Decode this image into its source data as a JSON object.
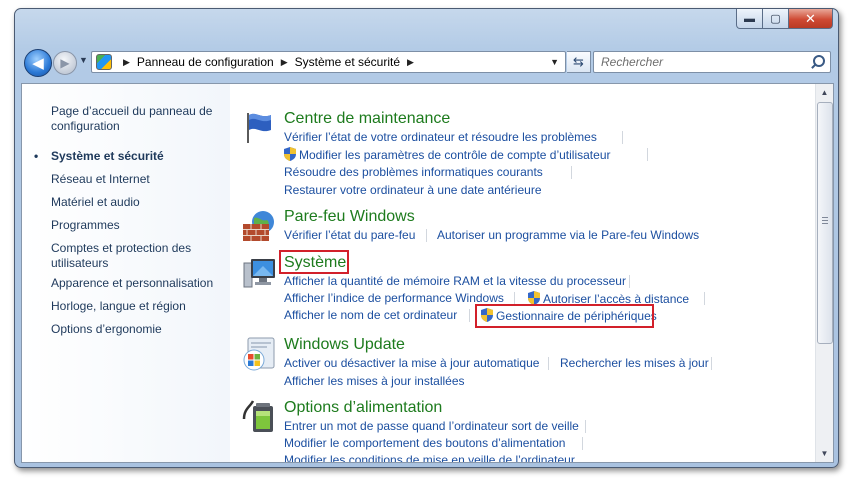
{
  "window": {
    "caption_minimize": "▬",
    "caption_maximize": "▢",
    "caption_close": "✕"
  },
  "toolbar": {
    "back_glyph": "◀",
    "forward_glyph": "▶",
    "history_glyph": "▼",
    "crumb_separator": "▶",
    "breadcrumbs": [
      "Panneau de configuration",
      "Système et sécurité"
    ],
    "address_dropdown_glyph": "▼",
    "refresh_glyph": "⇆",
    "search_placeholder": "Rechercher"
  },
  "sidebar": {
    "items": [
      {
        "label": "Page d’accueil du panneau de configuration"
      },
      {
        "label": "Système et sécurité",
        "active": true,
        "bullet": "•"
      },
      {
        "label": "Réseau et Internet"
      },
      {
        "label": "Matériel et audio"
      },
      {
        "label": "Programmes"
      },
      {
        "label": "Comptes et protection des utilisateurs"
      },
      {
        "label": "Apparence et personnalisation"
      },
      {
        "label": "Horloge, langue et région"
      },
      {
        "label": "Options d’ergonomie"
      }
    ]
  },
  "categories": [
    {
      "title": "Centre de maintenance",
      "icon": "flag-icon",
      "links": [
        "Vérifier l’état de votre ordinateur et résoudre les problèmes",
        "Modifier les paramètres de contrôle de compte d’utilisateur",
        "Résoudre des problèmes informatiques courants",
        "Restaurer votre ordinateur à une date antérieure"
      ]
    },
    {
      "title": "Pare-feu Windows",
      "icon": "firewall-icon",
      "links": [
        "Vérifier l’état du pare-feu",
        "Autoriser un programme via le Pare-feu Windows"
      ]
    },
    {
      "title": "Système",
      "icon": "computer-icon",
      "links": [
        "Afficher la quantité de mémoire RAM et la vitesse du processeur",
        "Afficher l’indice de performance Windows",
        "Autoriser l’accès à distance",
        "Afficher le nom de cet ordinateur",
        "Gestionnaire de périphériques"
      ]
    },
    {
      "title": "Windows Update",
      "icon": "windows-update-icon",
      "links": [
        "Activer ou désactiver la mise à jour automatique",
        "Rechercher les mises à jour",
        "Afficher les mises à jour installées"
      ]
    },
    {
      "title": "Options d’alimentation",
      "icon": "power-options-icon",
      "links": [
        "Entrer un mot de passe quand l’ordinateur sort de veille",
        "Modifier le comportement des boutons d’alimentation",
        "Modifier les conditions de mise en veille de l’ordinateur"
      ]
    }
  ],
  "scrollbar": {
    "up_glyph": "▲",
    "down_glyph": "▼"
  },
  "colors": {
    "category_title": "#1d7b1d",
    "link": "#1c4fa0",
    "highlight_box": "#d2202a",
    "nav_text": "#1e395b"
  }
}
